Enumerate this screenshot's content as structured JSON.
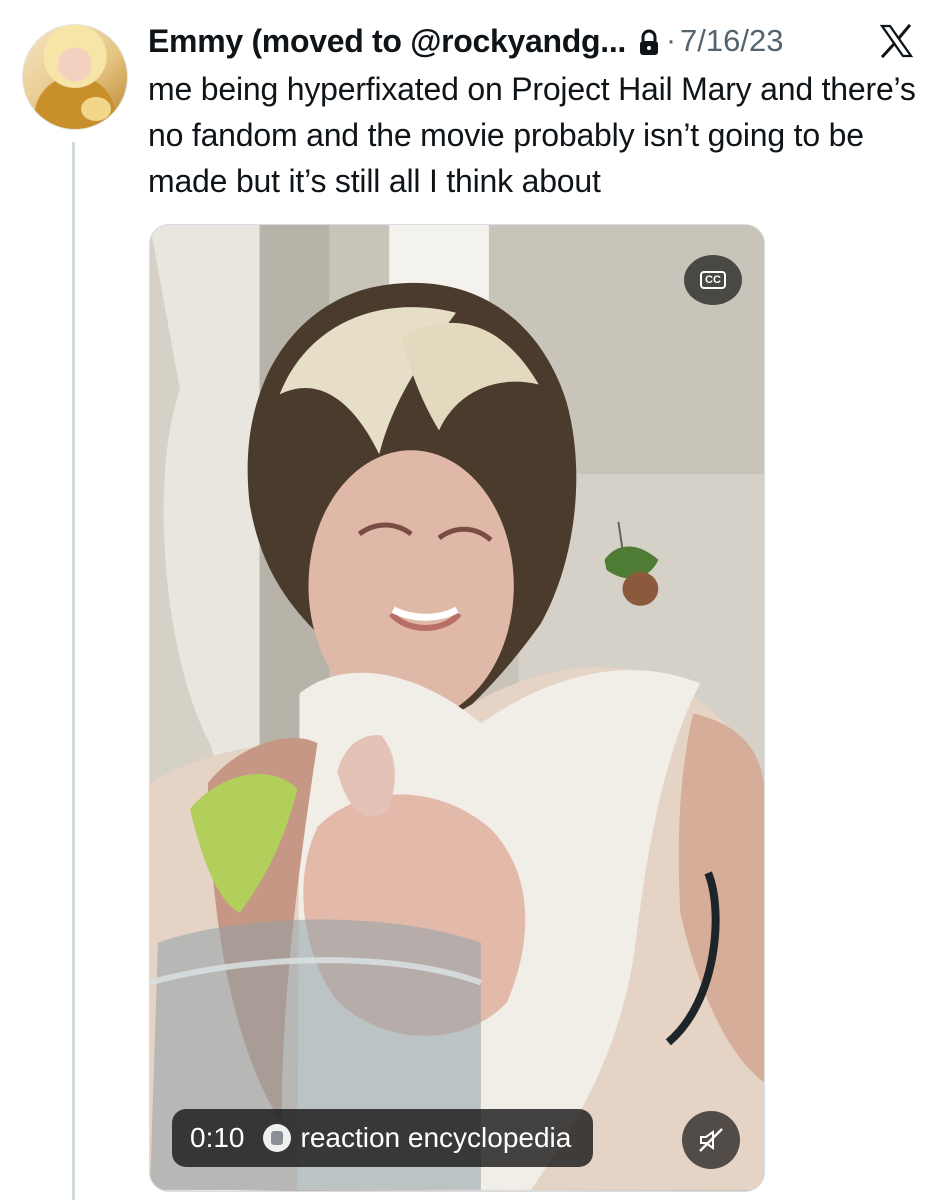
{
  "tweet": {
    "author_name": "Emmy (moved to @rockyandg...",
    "date": "7/16/23",
    "separator": "·",
    "text": "me being hyperfixated on Project Hail Mary and there’s no fandom and the movie probably isn’t going to be made but it’s still all I think about",
    "icons": {
      "avatar": "user-avatar",
      "lock": "lock-icon",
      "brand": "x-logo"
    }
  },
  "video": {
    "timestamp": "0:10",
    "source": "reaction encyclopedia",
    "captions_label": "CC",
    "icons": {
      "captions": "closed-captions-icon",
      "source": "source-icon",
      "mute": "muted-speaker-icon"
    }
  },
  "colors": {
    "text_primary": "#0f1419",
    "text_secondary": "#536471",
    "thread_line": "#cfd9de",
    "overlay": "#121212"
  }
}
